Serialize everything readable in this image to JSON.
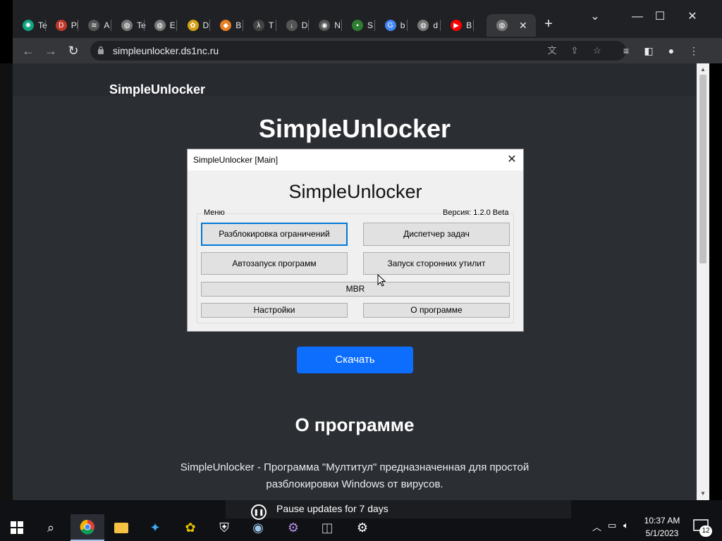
{
  "browser": {
    "tabs": [
      {
        "label": "Te",
        "icon": "openai-icon",
        "color": "#10a37f"
      },
      {
        "label": "Pl",
        "icon": "dts-icon",
        "color": "#c0392b"
      },
      {
        "label": "A",
        "icon": "stack-icon",
        "color": "#555555"
      },
      {
        "label": "Te",
        "icon": "globe-icon",
        "color": "#777777"
      },
      {
        "label": "E",
        "icon": "globe-icon",
        "color": "#777777"
      },
      {
        "label": "D",
        "icon": "bee-icon",
        "color": "#d4a017"
      },
      {
        "label": "B",
        "icon": "diamond-icon",
        "color": "#e67e22"
      },
      {
        "label": "T",
        "icon": "lambda-icon",
        "color": "#444444"
      },
      {
        "label": "D",
        "icon": "download-icon",
        "color": "#555555"
      },
      {
        "label": "N",
        "icon": "chrome-icon",
        "color": "#555555"
      },
      {
        "label": "S",
        "icon": "terminal-icon",
        "color": "#2e7d32"
      },
      {
        "label": "b",
        "icon": "google-icon",
        "color": "#4285f4"
      },
      {
        "label": "d",
        "icon": "globe-icon",
        "color": "#777777"
      },
      {
        "label": "B",
        "icon": "youtube-icon",
        "color": "#ff0000"
      }
    ],
    "active_tab_icon": "globe-icon",
    "url": "simpleunlocker.ds1nc.ru"
  },
  "page": {
    "site_name": "SimpleUnlocker",
    "hero_title": "SimpleUnlocker",
    "download_label": "Скачать",
    "about_title": "О программе",
    "about_text": "SimpleUnlocker - Программа \"Мултитул\" предназначенная для простой разблокировки Windows от вирусов."
  },
  "dialog": {
    "title": "SimpleUnlocker [Main]",
    "app_title": "SimpleUnlocker",
    "menu_label": "Меню",
    "version": "Версия: 1.2.0 Beta",
    "buttons": {
      "unlock": "Разблокировка ограничений",
      "taskmgr": "Диспетчер задач",
      "autorun": "Автозапуск программ",
      "utilities": "Запуск сторонних утилит",
      "mbr": "MBR",
      "settings": "Настройки",
      "about": "О программе"
    }
  },
  "taskbar": {
    "toast": "Pause updates for 7 days",
    "time": "10:37 AM",
    "date": "5/1/2023",
    "notification_count": "12"
  },
  "colors": {
    "page_bg": "#2b2e33",
    "accent": "#0d6efd",
    "focus": "#0078d7"
  }
}
